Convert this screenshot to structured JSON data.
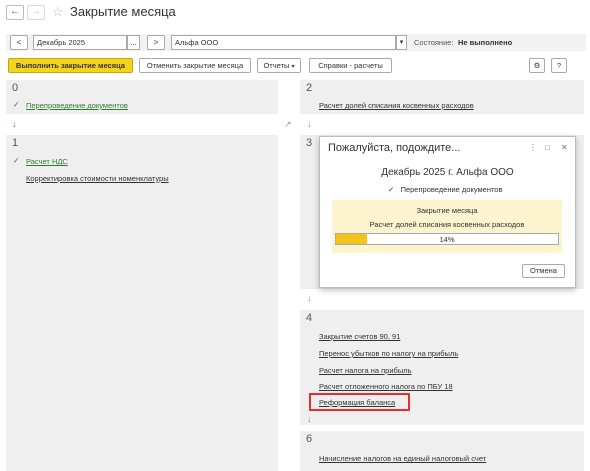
{
  "window": {
    "title": "Закрытие месяца",
    "back_icon": "←",
    "forward_icon": "→",
    "star_icon": "☆"
  },
  "filter": {
    "prev_label": "<",
    "period": "Декабрь 2025",
    "period_select": "...",
    "next_label": ">",
    "organization": "Альфа ООО",
    "org_dropdown": "▾",
    "state_label": "Состояние:",
    "state_value": "Не выполнено"
  },
  "toolbar": {
    "run": "Выполнить закрытие месяца",
    "cancel": "Отменить закрытие месяца",
    "reports": "Отчеты",
    "reports_caret": "▾",
    "help": "Справки - расчеты",
    "settings_icon": "⚙",
    "help_icon": "?"
  },
  "stages": [
    {
      "num": "0",
      "items": [
        "Перепроведение документов"
      ]
    },
    {
      "num": "1",
      "items": [
        "Расчет НДС",
        "Корректировка стоимости номенклатуры"
      ]
    },
    {
      "num": "2",
      "items": [
        "Расчет долей списания косвенных расходов"
      ]
    },
    {
      "num": "3",
      "items": []
    },
    {
      "num": "4",
      "items": [
        "Закрытие счетов 90, 91",
        "Перенос убытков по налогу на прибыль",
        "Расчет налога на прибыль",
        "Расчет отложенного налога по ПБУ 18",
        "Реформация баланса"
      ]
    },
    {
      "num": "6",
      "items": [
        "Начисление налогов на единый налоговый счет"
      ]
    }
  ],
  "icons": {
    "check": "✓",
    "arrow_down": "↓",
    "arrow_diag": "↗"
  },
  "modal": {
    "title": "Пожалуйста, подождите...",
    "menu_icon": "⋮",
    "maximize_icon": "□",
    "close_icon": "✕",
    "subtitle": "Декабрь 2025 г. Альфа ООО",
    "done_step": "Перепроведение документов",
    "box_title": "Закрытие месяца",
    "box_sub": "Расчет долей списания косвенных расходов",
    "progress": 14,
    "progress_text": "14%",
    "cancel": "Отмена"
  },
  "colors": {
    "accent": "#f3d31c",
    "panel": "#efefef",
    "link_green": "#2e7d32",
    "highlight": "#e03030"
  }
}
